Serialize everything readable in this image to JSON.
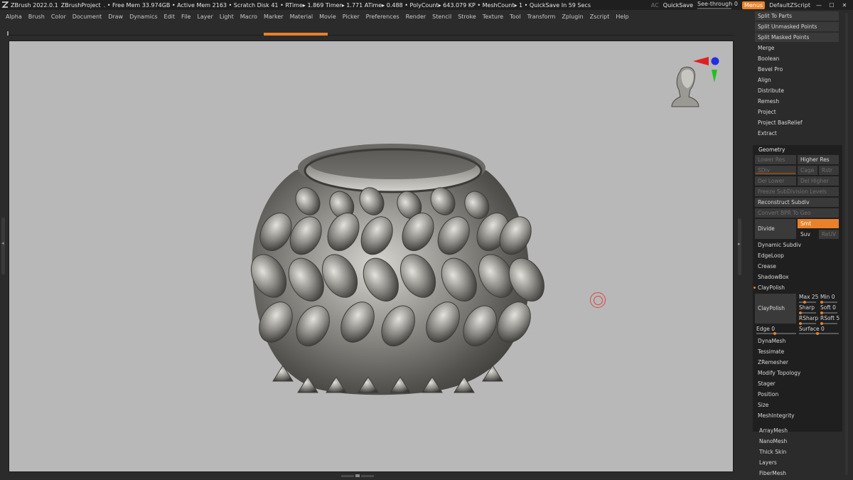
{
  "titlebar": {
    "app": "ZBrush 2022.0.1",
    "project": "ZBrushProject",
    "stats": ". • Free Mem 33.974GB • Active Mem 2163 • Scratch Disk 41 •  RTime▸ 1.869 Timer▸ 1.771 ATime▸ 0.488 • PolyCount▸ 643.079 KP  • MeshCount▸ 1  • QuickSave In 59 Secs",
    "ac": "AC",
    "quicksave": "QuickSave",
    "seethrough_label": "See-through",
    "seethrough_value": "0",
    "seethrough_fraction": 0,
    "menus": "Menus",
    "script": "DefaultZScript",
    "window_controls": [
      "—",
      "☐",
      "✕"
    ]
  },
  "menubar": [
    "Alpha",
    "Brush",
    "Color",
    "Document",
    "Draw",
    "Dynamics",
    "Edit",
    "File",
    "Layer",
    "Light",
    "Macro",
    "Marker",
    "Material",
    "Movie",
    "Picker",
    "Preferences",
    "Render",
    "Stencil",
    "Stroke",
    "Texture",
    "Tool",
    "Transform",
    "Zplugin",
    "Zscript",
    "Help"
  ],
  "subtool_actions": [
    "Split To Parts",
    "Split Unmasked Points",
    "Split Masked Points",
    "Merge",
    "Boolean",
    "Bevel Pro",
    "Align",
    "Distribute",
    "Remesh",
    "Project",
    "Project BasRelief",
    "Extract"
  ],
  "geometry": {
    "title": "Geometry",
    "lower_res": "Lower Res",
    "higher_res": "Higher Res",
    "sdiv": "SDiv",
    "cage": "Cage",
    "rstr": "Rstr",
    "del_lower": "Del Lower",
    "del_higher": "Del Higher",
    "freeze": "Freeze SubDivision Levels",
    "reconstruct": "Reconstruct Subdiv",
    "convert_bpr": "Convert BPR To Geo",
    "divide": "Divide",
    "smt": "Smt",
    "suv": "Suv",
    "reuv": "ReUV",
    "dynamic_subdiv": "Dynamic Subdiv",
    "edgeloop": "EdgeLoop",
    "crease": "Crease",
    "shadowbox": "ShadowBox",
    "claypolish_toggle": "ClayPolish",
    "claypolish": "ClayPolish",
    "max": "Max 25",
    "min": "Min 0",
    "sharp": "Sharp",
    "soft": "Soft 0",
    "rsharp": "RSharp",
    "rsoft": "RSoft 5",
    "edge": "Edge 0",
    "surface": "Surface 0",
    "items": [
      "DynaMesh",
      "Tessimate",
      "ZRemesher",
      "Modify Topology",
      "Stager",
      "Position",
      "Size",
      "MeshIntegrity"
    ]
  },
  "bottom_items": [
    "ArrayMesh",
    "NanoMesh",
    "Thick Skin",
    "Layers",
    "FiberMesh"
  ],
  "colors": {
    "accent": "#e8812a",
    "canvas": "#b8b8b8",
    "panel": "#2b2b2b"
  }
}
